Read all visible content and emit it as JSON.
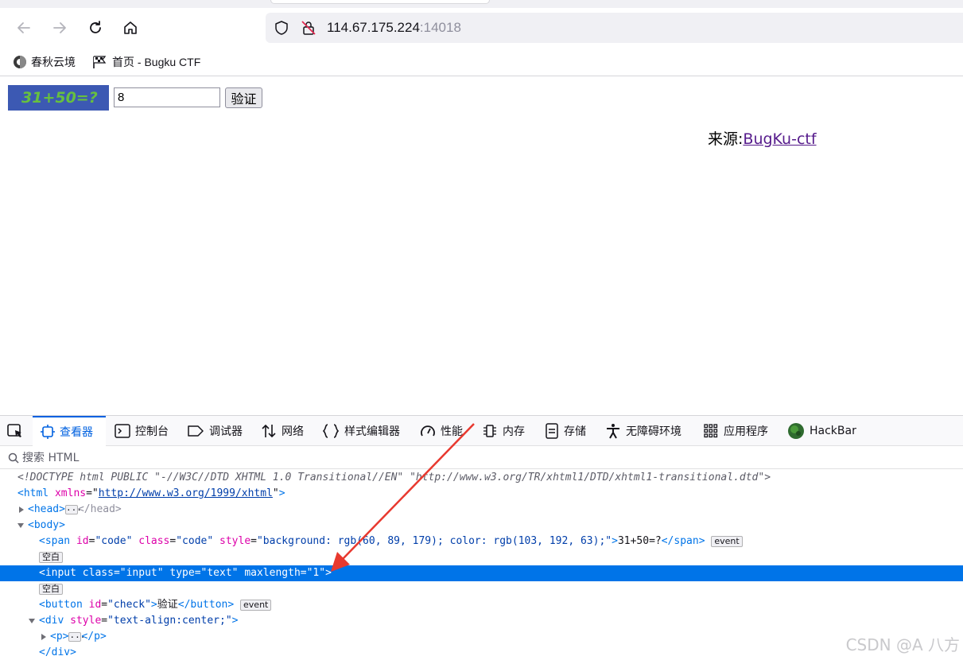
{
  "browser": {
    "url_host": "114.67.175.224",
    "url_port": ":14018",
    "bookmarks": [
      {
        "label": "春秋云境"
      },
      {
        "label": "首页 - Bugku CTF"
      }
    ]
  },
  "page": {
    "captcha_text": "31+50=?",
    "captcha_colors": {
      "background": "#3c59b3",
      "text": "#67c03f"
    },
    "answer_value": "8",
    "check_button": "验证",
    "source_label": "来源:",
    "source_link": "BugKu-ctf"
  },
  "devtools": {
    "tabs": [
      {
        "label": "查看器",
        "icon": "inspector-icon",
        "active": true
      },
      {
        "label": "控制台",
        "icon": "console-icon"
      },
      {
        "label": "调试器",
        "icon": "debugger-icon"
      },
      {
        "label": "网络",
        "icon": "network-icon"
      },
      {
        "label": "样式编辑器",
        "icon": "style-editor-icon"
      },
      {
        "label": "性能",
        "icon": "performance-icon"
      },
      {
        "label": "内存",
        "icon": "memory-icon"
      },
      {
        "label": "存储",
        "icon": "storage-icon"
      },
      {
        "label": "无障碍环境",
        "icon": "accessibility-icon"
      },
      {
        "label": "应用程序",
        "icon": "application-icon"
      },
      {
        "label": "HackBar",
        "icon": "hackbar-icon"
      }
    ],
    "search_placeholder": "搜索 HTML",
    "tree": {
      "doctype": "<!DOCTYPE html PUBLIC \"-//W3C//DTD XHTML 1.0 Transitional//EN\" \"http://www.w3.org/TR/xhtml1/DTD/xhtml1-transitional.dtd\">",
      "html_open": "<html",
      "html_attr": "xmlns",
      "html_value": "http://www.w3.org/1999/xhtml",
      "head_open": "<head>",
      "head_close": "</head>",
      "body_open": "<body>",
      "span_tag": "<span",
      "span_id_attr": "id",
      "span_id_val": "\"code\"",
      "span_class_attr": "class",
      "span_class_val": "\"code\"",
      "span_style_attr": "style",
      "span_style_val": "\"background: rgb(60, 89, 179); color: rgb(103, 192, 63);\"",
      "span_text": "31+50=?",
      "span_close": "</span>",
      "event_badge": "event",
      "whitespace_badge": "空白",
      "input_tag": "<input",
      "input_class_attr": "class",
      "input_class_val": "\"input\"",
      "input_type_attr": "type",
      "input_type_val": "\"text\"",
      "input_max_attr": "maxlength",
      "input_max_val": "\"1\"",
      "button_tag": "<button",
      "button_id_attr": "id",
      "button_id_val": "\"check\"",
      "button_text": "验证",
      "button_close": "</button>",
      "div_tag": "<div",
      "div_style_attr": "style",
      "div_style_val": "\"text-align:center;\"",
      "p_open": "<p>",
      "p_close": "</p>",
      "div_close": "</div>"
    }
  },
  "watermark": "CSDN @A  八方",
  "annotation_color": "#e8392f"
}
